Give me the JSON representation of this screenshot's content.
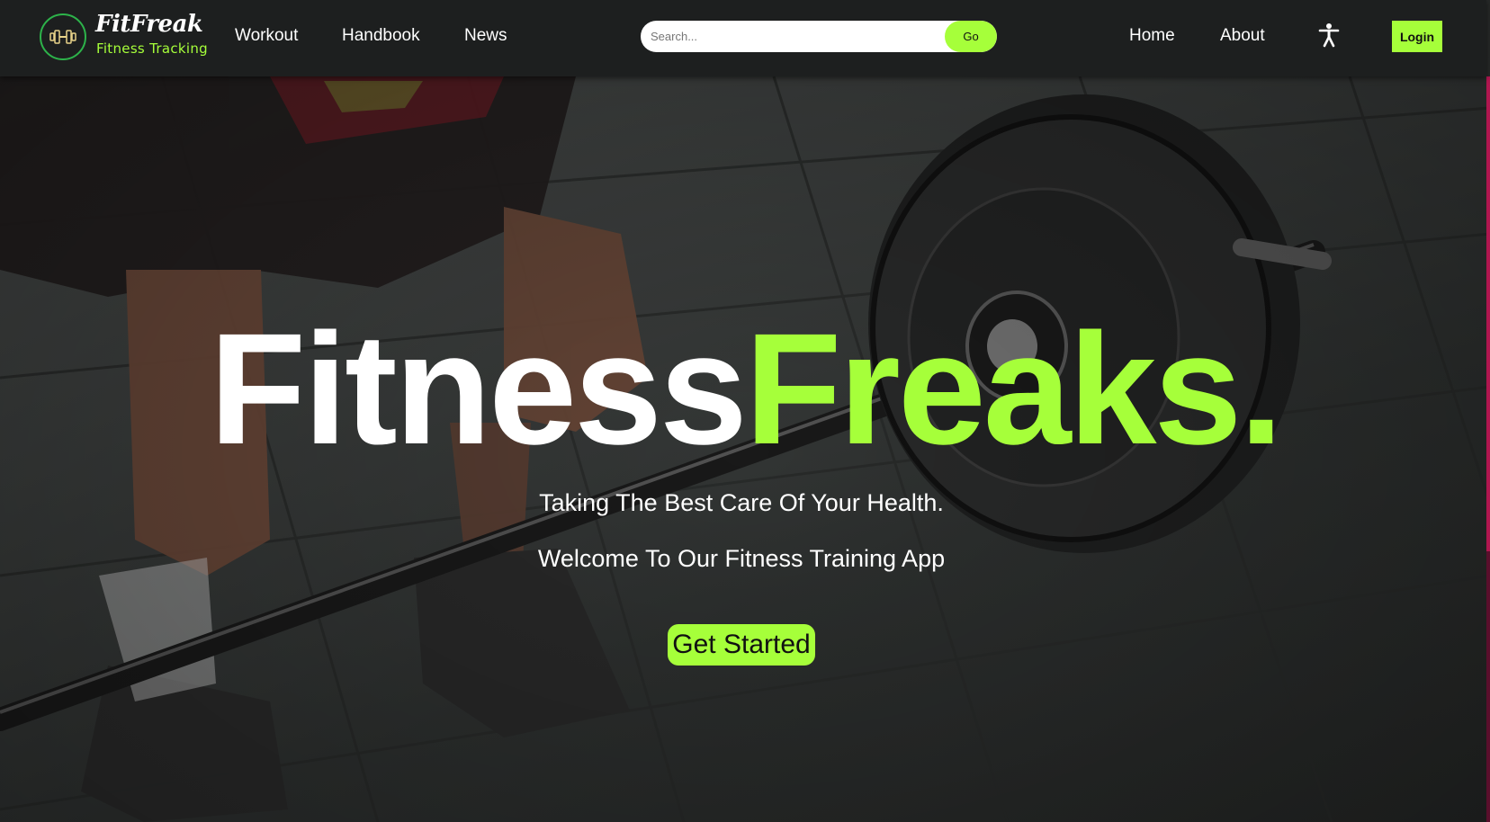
{
  "brand": {
    "name": "FitFreak",
    "subtitle": "Fitness Tracking",
    "logo_icon": "dumbbell-icon"
  },
  "nav": {
    "left_links": [
      "Workout",
      "Handbook",
      "News"
    ],
    "right_links": [
      "Home",
      "About"
    ],
    "accessibility_icon": "accessibility-icon",
    "login_label": "Login"
  },
  "search": {
    "placeholder": "Search...",
    "value": "",
    "button_label": "Go"
  },
  "hero": {
    "headline_white": "Fitness",
    "headline_green": "Freaks.",
    "tagline_1": "Taking The Best Care Of Your Health.",
    "tagline_2": "Welcome To Our Fitness Training App",
    "cta_label": "Get Started",
    "background_icon": "barbell-deadlift-photo"
  },
  "colors": {
    "accent": "#a6ff3a",
    "nav_bg": "#1d1f1f",
    "logo_ring": "#2db34a",
    "edge": "#b0164f"
  }
}
